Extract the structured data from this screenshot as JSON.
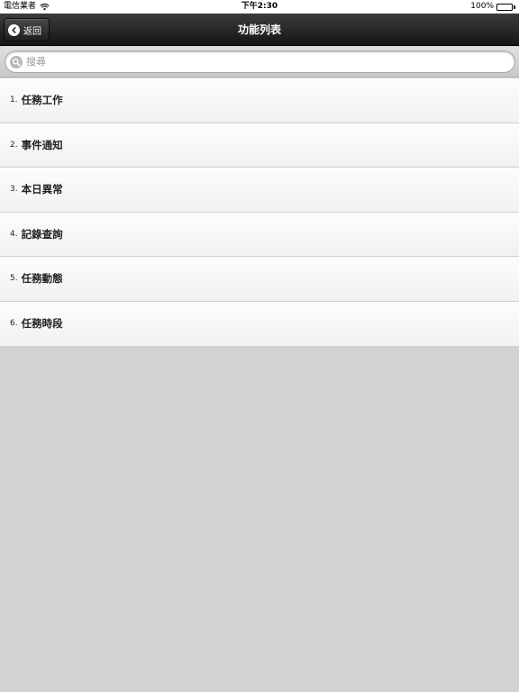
{
  "status_bar": {
    "carrier": "電信業者",
    "time": "下午2:30",
    "battery": "100%",
    "battery_level": 1.0
  },
  "nav": {
    "title": "功能列表",
    "back_label": "返回"
  },
  "search": {
    "placeholder": "搜尋"
  },
  "list": {
    "items": [
      {
        "num": "1.",
        "label": "任務工作"
      },
      {
        "num": "2.",
        "label": "事件通知"
      },
      {
        "num": "3.",
        "label": "本日異常"
      },
      {
        "num": "4.",
        "label": "記錄查詢"
      },
      {
        "num": "5.",
        "label": "任務動態"
      },
      {
        "num": "6.",
        "label": "任務時段"
      }
    ]
  },
  "colors": {
    "nav_background": "#1e1e1e",
    "page_background": "#d2d2d2",
    "list_background": "#f7f7f7"
  },
  "icons": [
    "wifi-icon",
    "battery-icon",
    "back-chevron-icon",
    "search-icon"
  ]
}
